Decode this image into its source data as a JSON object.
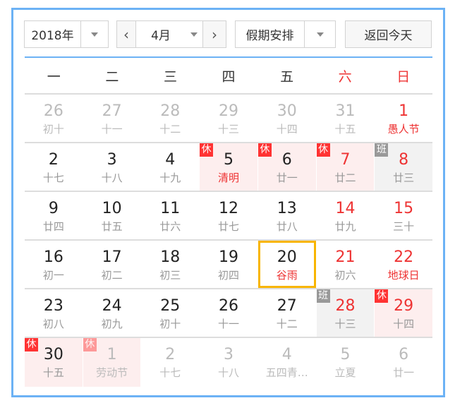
{
  "controls": {
    "year": "2018年",
    "month": "4月",
    "prev": "‹",
    "next": "›",
    "holiday": "假期安排",
    "today_button": "返回今天"
  },
  "weekdays": [
    "一",
    "二",
    "三",
    "四",
    "五",
    "六",
    "日"
  ],
  "colors": {
    "accent": "#6cb2f5",
    "holiday_red": "#ff3333",
    "selected": "#f8b500"
  },
  "tags": {
    "rest": "休",
    "work": "班"
  },
  "weeks": [
    [
      {
        "d": "26",
        "l": "初十",
        "o": 1
      },
      {
        "d": "27",
        "l": "十一",
        "o": 1
      },
      {
        "d": "28",
        "l": "十二",
        "o": 1
      },
      {
        "d": "29",
        "l": "十三",
        "o": 1
      },
      {
        "d": "30",
        "l": "十四",
        "o": 1
      },
      {
        "d": "31",
        "l": "十五",
        "o": 1
      },
      {
        "d": "1",
        "l": "愚人节",
        "f": 1
      }
    ],
    [
      {
        "d": "2",
        "l": "十七"
      },
      {
        "d": "3",
        "l": "十八"
      },
      {
        "d": "4",
        "l": "十九"
      },
      {
        "d": "5",
        "l": "清明",
        "f": 1,
        "t": "rest"
      },
      {
        "d": "6",
        "l": "廿一",
        "t": "rest"
      },
      {
        "d": "7",
        "l": "廿二",
        "t": "rest"
      },
      {
        "d": "8",
        "l": "廿三",
        "t": "work"
      }
    ],
    [
      {
        "d": "9",
        "l": "廿四"
      },
      {
        "d": "10",
        "l": "廿五"
      },
      {
        "d": "11",
        "l": "廿六"
      },
      {
        "d": "12",
        "l": "廿七"
      },
      {
        "d": "13",
        "l": "廿八"
      },
      {
        "d": "14",
        "l": "廿九"
      },
      {
        "d": "15",
        "l": "三十"
      }
    ],
    [
      {
        "d": "16",
        "l": "初一"
      },
      {
        "d": "17",
        "l": "初二"
      },
      {
        "d": "18",
        "l": "初三"
      },
      {
        "d": "19",
        "l": "初四"
      },
      {
        "d": "20",
        "l": "谷雨",
        "f": 1,
        "s": 1
      },
      {
        "d": "21",
        "l": "初六"
      },
      {
        "d": "22",
        "l": "地球日",
        "f": 1
      }
    ],
    [
      {
        "d": "23",
        "l": "初八"
      },
      {
        "d": "24",
        "l": "初九"
      },
      {
        "d": "25",
        "l": "初十"
      },
      {
        "d": "26",
        "l": "十一"
      },
      {
        "d": "27",
        "l": "十二"
      },
      {
        "d": "28",
        "l": "十三",
        "t": "work"
      },
      {
        "d": "29",
        "l": "十四",
        "t": "rest"
      }
    ],
    [
      {
        "d": "30",
        "l": "十五",
        "t": "rest"
      },
      {
        "d": "1",
        "l": "劳动节",
        "o": 1,
        "f": 1,
        "t": "rest"
      },
      {
        "d": "2",
        "l": "十七",
        "o": 1
      },
      {
        "d": "3",
        "l": "十八",
        "o": 1
      },
      {
        "d": "4",
        "l": "五四青…",
        "o": 1
      },
      {
        "d": "5",
        "l": "立夏",
        "o": 1
      },
      {
        "d": "6",
        "l": "廿一",
        "o": 1
      }
    ]
  ]
}
